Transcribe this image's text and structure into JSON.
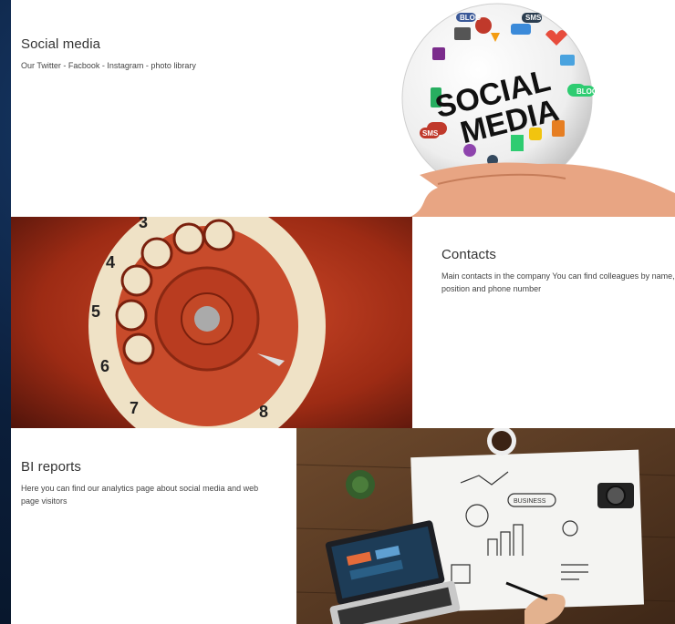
{
  "sections": {
    "social": {
      "title": "Social media",
      "description": "Our Twitter - Facbook - Instagram - photo library",
      "image": {
        "line1": "SOCIAL",
        "line2": "MEDIA",
        "badges": [
          "SMS",
          "BLOG",
          "SMS",
          "BLOG"
        ],
        "icon": "social-media-globe-icon"
      }
    },
    "contacts": {
      "title": "Contacts",
      "description": "Main contacts in the company You can find colleagues by name, position and phone number",
      "image": {
        "icon": "rotary-phone-dial-image",
        "digits": [
          "3",
          "4",
          "5",
          "6",
          "7",
          "8"
        ]
      }
    },
    "bi": {
      "title": "BI reports",
      "description": "Here you can find our analytics page about social media and web page visitors",
      "image": {
        "icon": "business-desk-sketch-image",
        "sketch_label": "BUSINESS"
      }
    }
  },
  "colors": {
    "background": "#0b1e3a",
    "card": "#ffffff",
    "title": "#333333",
    "text": "#444444"
  }
}
